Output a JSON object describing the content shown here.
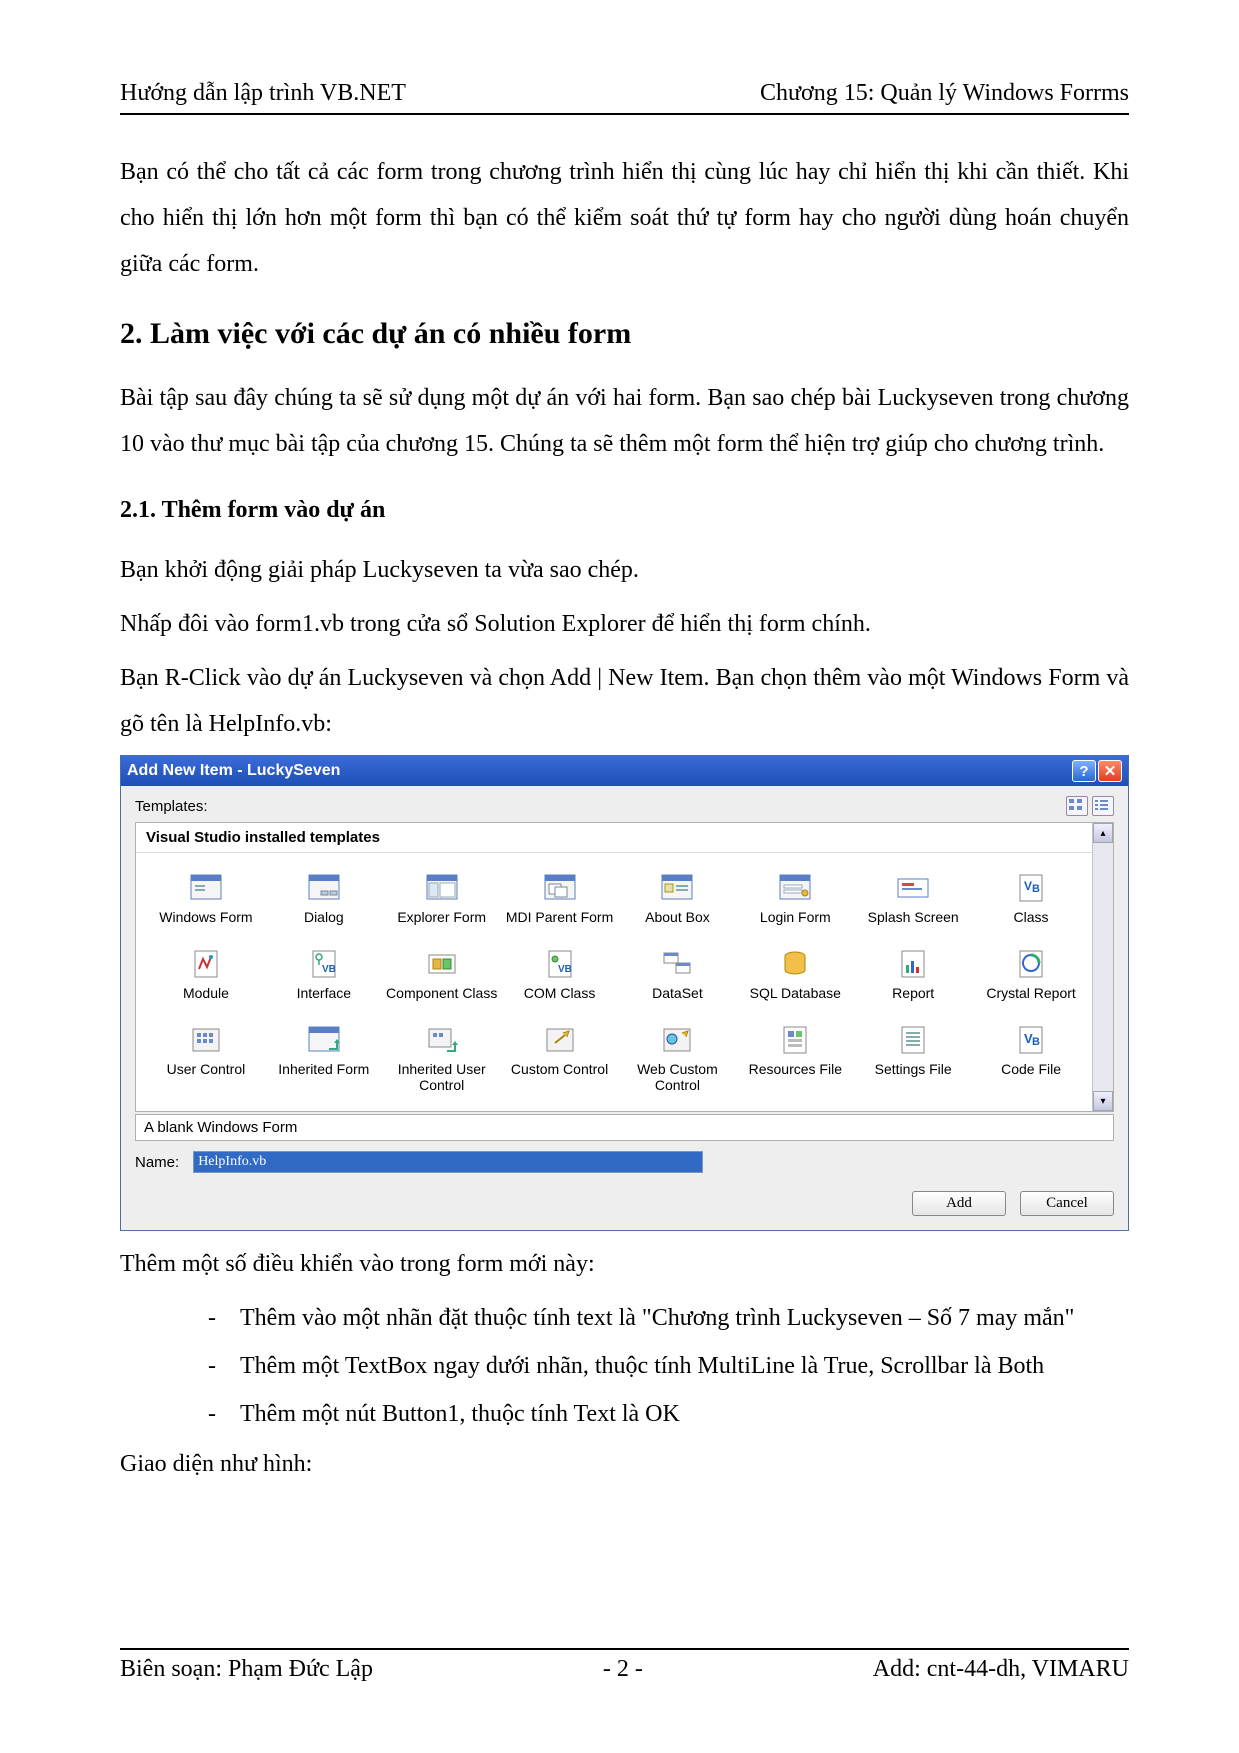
{
  "header": {
    "left": "Hướng dẫn lập trình VB.NET",
    "right": "Chương 15: Quản lý Windows Forrms"
  },
  "intro_p": "Bạn có thể cho tất cả các form trong chương trình hiển thị cùng lúc hay chỉ hiển thị khi cần thiết. Khi cho hiển thị lớn hơn một form thì bạn có thể kiểm soát thứ tự form hay cho người dùng hoán chuyển giữa các form.",
  "h2": "2. Làm việc với các dự án có nhiều form",
  "p2": "Bài tập sau đây chúng ta sẽ sử dụng một dự án với hai form. Bạn sao chép bài Luckyseven trong chương 10 vào thư mục bài tập của chương 15. Chúng ta sẽ thêm một form thể hiện trợ giúp cho chương trình.",
  "h3": "2.1. Thêm form vào dự án",
  "p3a": "Bạn khởi động giải pháp Luckyseven ta vừa sao chép.",
  "p3b": "Nhấp đôi vào form1.vb trong cửa sổ Solution Explorer để hiển thị form chính.",
  "p3c": "Bạn R-Click vào dự án Luckyseven và chọn Add | New Item. Bạn chọn thêm vào một Windows Form và gõ tên là HelpInfo.vb:",
  "dialog": {
    "title": "Add New Item - LuckySeven",
    "templates_label": "Templates:",
    "section_title": "Visual Studio installed templates",
    "items": [
      {
        "name": "windows-form",
        "label": "Windows Form"
      },
      {
        "name": "dialog",
        "label": "Dialog"
      },
      {
        "name": "explorer-form",
        "label": "Explorer Form"
      },
      {
        "name": "mdi-parent-form",
        "label": "MDI Parent Form"
      },
      {
        "name": "about-box",
        "label": "About Box"
      },
      {
        "name": "login-form",
        "label": "Login Form"
      },
      {
        "name": "splash-screen",
        "label": "Splash Screen"
      },
      {
        "name": "class",
        "label": "Class"
      },
      {
        "name": "module",
        "label": "Module"
      },
      {
        "name": "interface",
        "label": "Interface"
      },
      {
        "name": "component-class",
        "label": "Component Class"
      },
      {
        "name": "com-class",
        "label": "COM Class"
      },
      {
        "name": "dataset",
        "label": "DataSet"
      },
      {
        "name": "sql-database",
        "label": "SQL Database"
      },
      {
        "name": "report",
        "label": "Report"
      },
      {
        "name": "crystal-report",
        "label": "Crystal Report"
      },
      {
        "name": "user-control",
        "label": "User Control"
      },
      {
        "name": "inherited-form",
        "label": "Inherited Form"
      },
      {
        "name": "inherited-user-control",
        "label": "Inherited User Control"
      },
      {
        "name": "custom-control",
        "label": "Custom Control"
      },
      {
        "name": "web-custom-control",
        "label": "Web Custom Control"
      },
      {
        "name": "resources-file",
        "label": "Resources File"
      },
      {
        "name": "settings-file",
        "label": "Settings File"
      },
      {
        "name": "code-file",
        "label": "Code File"
      }
    ],
    "description": "A blank Windows Form",
    "name_label": "Name:",
    "name_value": "HelpInfo.vb",
    "add_btn": "Add",
    "cancel_btn": "Cancel"
  },
  "p4": "Thêm một số điều khiển vào trong form mới này:",
  "bullets": [
    "Thêm vào một nhãn đặt thuộc tính text là \"Chương trình Luckyseven – Số 7 may mắn\"",
    "Thêm một TextBox ngay dưới nhãn, thuộc tính MultiLine là True, Scrollbar là Both",
    "Thêm một nút Button1, thuộc tính Text là OK"
  ],
  "p5": "Giao diện như hình:",
  "footer": {
    "left": "Biên soạn: Phạm Đức Lập",
    "center": "- 2 -",
    "right": "Add: cnt-44-dh, VIMARU"
  }
}
